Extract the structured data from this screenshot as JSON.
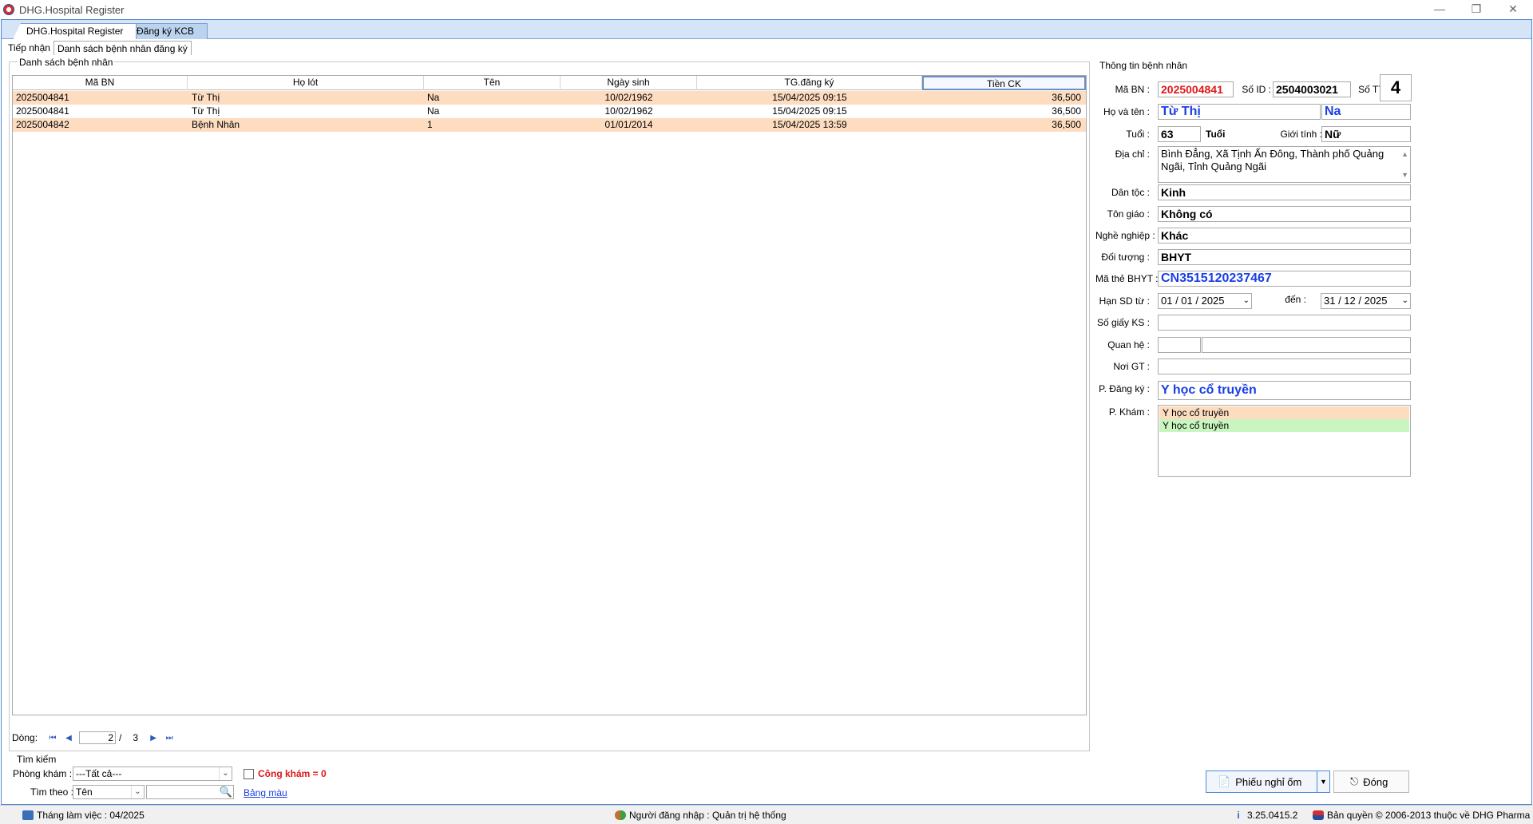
{
  "window": {
    "title": "DHG.Hospital Register",
    "icon": "app-logo-icon"
  },
  "tabs": [
    {
      "label": "DHG.Hospital Register"
    },
    {
      "label": "Đăng ký KCB"
    }
  ],
  "subtabs": [
    {
      "label": "Tiếp nhận"
    },
    {
      "label": "Danh sách bệnh nhân đăng ký"
    }
  ],
  "list": {
    "group_title": "Danh sách bệnh nhân",
    "columns": [
      "Mã BN",
      "Họ lót",
      "Tên",
      "Ngày sinh",
      "TG.đăng ký",
      "Tiền CK"
    ],
    "rows": [
      {
        "ma": "2025004841",
        "holot": "Từ Thị",
        "ten": "Na",
        "ngaysinh": "10/02/1962",
        "tg": "15/04/2025 09:15",
        "tien": "36,500"
      },
      {
        "ma": "2025004841",
        "holot": "Từ Thị",
        "ten": "Na",
        "ngaysinh": "10/02/1962",
        "tg": "15/04/2025 09:15",
        "tien": "36,500"
      },
      {
        "ma": "2025004842",
        "holot": "Bệnh Nhân",
        "ten": "1",
        "ngaysinh": "01/01/2014",
        "tg": "15/04/2025 13:59",
        "tien": "36,500"
      }
    ],
    "nav": {
      "label": "Dòng:",
      "current": "2",
      "sep": "/",
      "total": "3"
    }
  },
  "search": {
    "group_title": "Tìm kiếm",
    "phongkham_label": "Phòng khám :",
    "phongkham_value": "---Tất cả---",
    "congkham_label": "Công khám = 0",
    "timtheo_label": "Tìm theo :",
    "timtheo_value": "Tên",
    "bangmau": "Bảng màu"
  },
  "patient": {
    "group_title": "Thông tin bệnh nhân",
    "ma_bn_label": "Mã BN :",
    "ma_bn": "2025004841",
    "so_id_label": "Số ID :",
    "so_id": "2504003021",
    "so_tt_label": "Số TT :",
    "so_tt": "4",
    "hoten_label": "Họ và tên :",
    "holot": "Từ Thị",
    "ten": "Na",
    "tuoi_label": "Tuổi :",
    "tuoi": "63",
    "tuoi_unit": "Tuổi",
    "gioitinh_label": "Giới tính :",
    "gioitinh": "Nữ",
    "diachi_label": "Địa chỉ :",
    "diachi": "Bình Đẳng, Xã Tịnh Ấn Đông, Thành phố Quảng Ngãi, Tỉnh Quảng Ngãi",
    "dantoc_label": "Dân tộc :",
    "dantoc": "Kinh",
    "tongiao_label": "Tôn giáo :",
    "tongiao": "Không có",
    "nghenghiep_label": "Nghề nghiệp :",
    "nghenghiep": "Khác",
    "doituong_label": "Đối tượng :",
    "doituong": "BHYT",
    "mathe_label": "Mã thẻ BHYT :",
    "mathe": "CN3515120237467",
    "hansd_label": "Hạn SD từ :",
    "hansd_from": "01 / 01 / 2025",
    "den_label": "đến :",
    "hansd_to": "31 / 12 / 2025",
    "sogiayks_label": "Số giấy KS :",
    "sogiayks": "",
    "quanhe_label": "Quan hệ :",
    "noigt_label": "Nơi GT :",
    "noigt": "",
    "pdangky_label": "P. Đăng ký :",
    "pdangky": "Y học cổ truyền",
    "pkham_label": "P. Khám :",
    "pkham": [
      "Y học cổ truyền",
      "Y học cổ truyền"
    ]
  },
  "buttons": {
    "phieu": "Phiếu nghỉ ốm",
    "dong": "Đóng"
  },
  "status": {
    "thang": "Tháng làm việc : 04/2025",
    "nguoi": "Người đăng nhập : Quản trị hệ thống",
    "version": "3.25.0415.2",
    "banquyen": "Bản quyền © 2006-2013 thuộc về DHG Pharma"
  },
  "colors": {
    "accent": "#4f86d6",
    "row_orange": "#fddcc0",
    "row_green": "#c8f5c0",
    "red": "#e01818",
    "blue": "#1a3ee6"
  }
}
